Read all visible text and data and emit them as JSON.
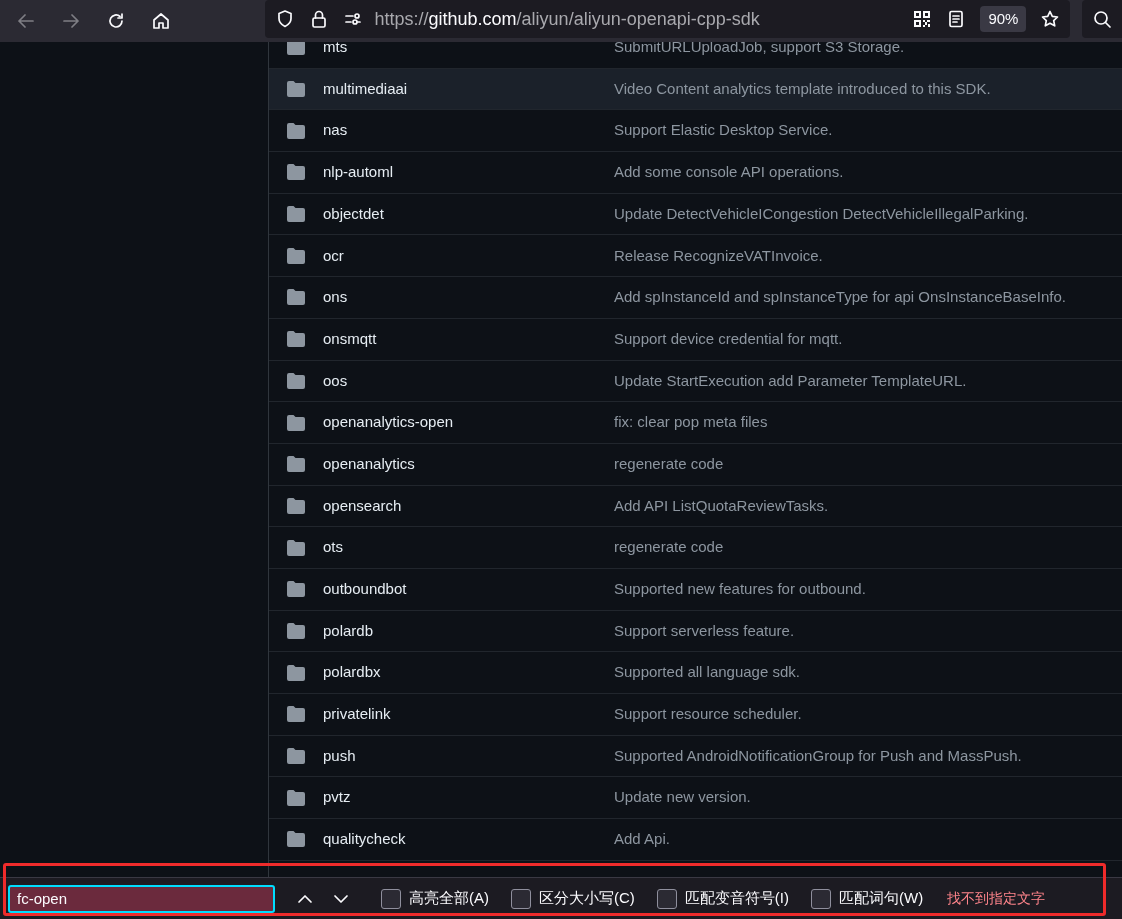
{
  "browser": {
    "url": {
      "scheme": "https://",
      "host": "github.com",
      "path": "/aliyun/aliyun-openapi-cpp-sdk"
    },
    "zoom": "90%"
  },
  "files": [
    {
      "name": "mts",
      "message": "SubmitURLUploadJob, support S3 Storage.",
      "highlighted": false
    },
    {
      "name": "multimediaai",
      "message": "Video Content analytics template introduced to this SDK.",
      "highlighted": true
    },
    {
      "name": "nas",
      "message": "Support Elastic Desktop Service.",
      "highlighted": false
    },
    {
      "name": "nlp-automl",
      "message": "Add some console API operations.",
      "highlighted": false
    },
    {
      "name": "objectdet",
      "message": "Update DetectVehicleICongestion DetectVehicleIllegalParking.",
      "highlighted": false
    },
    {
      "name": "ocr",
      "message": "Release RecognizeVATInvoice.",
      "highlighted": false
    },
    {
      "name": "ons",
      "message": "Add spInstanceId and spInstanceType for api OnsInstanceBaseInfo.",
      "highlighted": false
    },
    {
      "name": "onsmqtt",
      "message": "Support device credential for mqtt.",
      "highlighted": false
    },
    {
      "name": "oos",
      "message": "Update StartExecution add Parameter TemplateURL.",
      "highlighted": false
    },
    {
      "name": "openanalytics-open",
      "message": "fix: clear pop meta files",
      "highlighted": false
    },
    {
      "name": "openanalytics",
      "message": "regenerate code",
      "highlighted": false
    },
    {
      "name": "opensearch",
      "message": "Add API ListQuotaReviewTasks.",
      "highlighted": false
    },
    {
      "name": "ots",
      "message": "regenerate code",
      "highlighted": false
    },
    {
      "name": "outboundbot",
      "message": "Supported new features for outbound.",
      "highlighted": false
    },
    {
      "name": "polardb",
      "message": "Support serverless feature.",
      "highlighted": false
    },
    {
      "name": "polardbx",
      "message": "Supported all language sdk.",
      "highlighted": false
    },
    {
      "name": "privatelink",
      "message": "Support resource scheduler.",
      "highlighted": false
    },
    {
      "name": "push",
      "message": "Supported AndroidNotificationGroup for Push and MassPush.",
      "highlighted": false
    },
    {
      "name": "pvtz",
      "message": "Update new version.",
      "highlighted": false
    },
    {
      "name": "qualitycheck",
      "message": "Add Api.",
      "highlighted": false
    }
  ],
  "find_bar": {
    "value": "fc-open",
    "not_found": true,
    "options": [
      {
        "label": "高亮全部(A)",
        "checked": false
      },
      {
        "label": "区分大小写(C)",
        "checked": false
      },
      {
        "label": "匹配变音符号(I)",
        "checked": false
      },
      {
        "label": "匹配词句(W)",
        "checked": false
      }
    ],
    "status": "找不到指定文字"
  }
}
